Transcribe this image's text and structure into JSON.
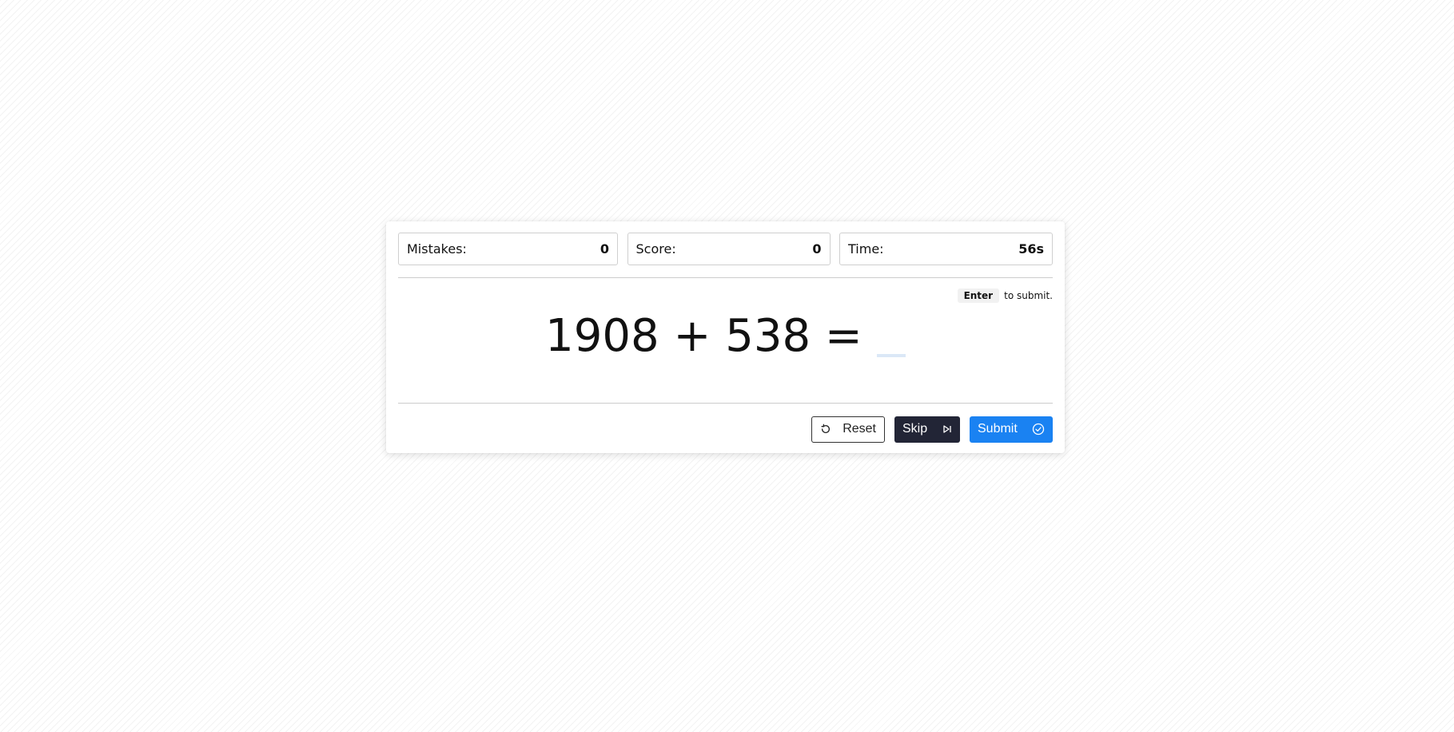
{
  "stats": {
    "mistakes": {
      "label": "Mistakes:",
      "value": "0"
    },
    "score": {
      "label": "Score:",
      "value": "0"
    },
    "time": {
      "label": "Time:",
      "value": "56s"
    }
  },
  "hint": {
    "key": "Enter",
    "text": "to submit."
  },
  "problem": {
    "expression": "1908 + 538 =",
    "answer_value": ""
  },
  "buttons": {
    "reset": {
      "label": "Reset",
      "icon": "reset-icon"
    },
    "skip": {
      "label": "Skip",
      "icon": "skip-icon"
    },
    "submit": {
      "label": "Submit",
      "icon": "check-circle-icon"
    }
  },
  "colors": {
    "submit": "#1a82f2",
    "skip": "#222536",
    "answer_underline": "#dbe8f7"
  }
}
